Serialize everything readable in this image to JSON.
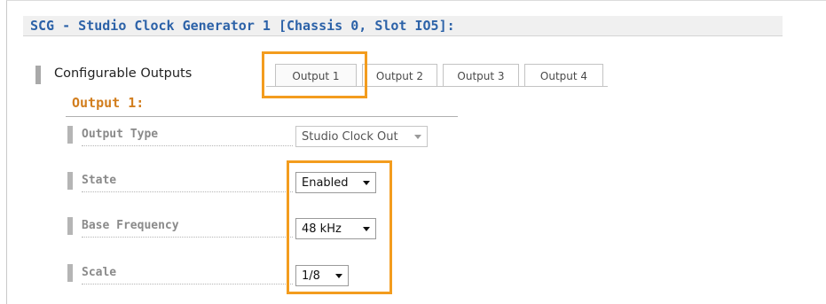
{
  "title": "SCG - Studio Clock Generator 1 [Chassis 0, Slot IO5]:",
  "section": {
    "label": "Configurable Outputs"
  },
  "tabs": [
    {
      "label": "Output 1",
      "active": true
    },
    {
      "label": "Output 2",
      "active": false
    },
    {
      "label": "Output 3",
      "active": false
    },
    {
      "label": "Output 4",
      "active": false
    }
  ],
  "output": {
    "heading": "Output 1:",
    "fields": {
      "output_type": {
        "label": "Output Type",
        "value": "Studio Clock Out",
        "enabled": false
      },
      "state": {
        "label": "State",
        "value": "Enabled",
        "enabled": true
      },
      "base_frequency": {
        "label": "Base Frequency",
        "value": "48 kHz",
        "enabled": true
      },
      "scale": {
        "label": "Scale",
        "value": "1/8",
        "enabled": true
      }
    }
  },
  "colors": {
    "title": "#2c62a8",
    "heading": "#d27e1e",
    "highlight": "#f39c1e"
  }
}
